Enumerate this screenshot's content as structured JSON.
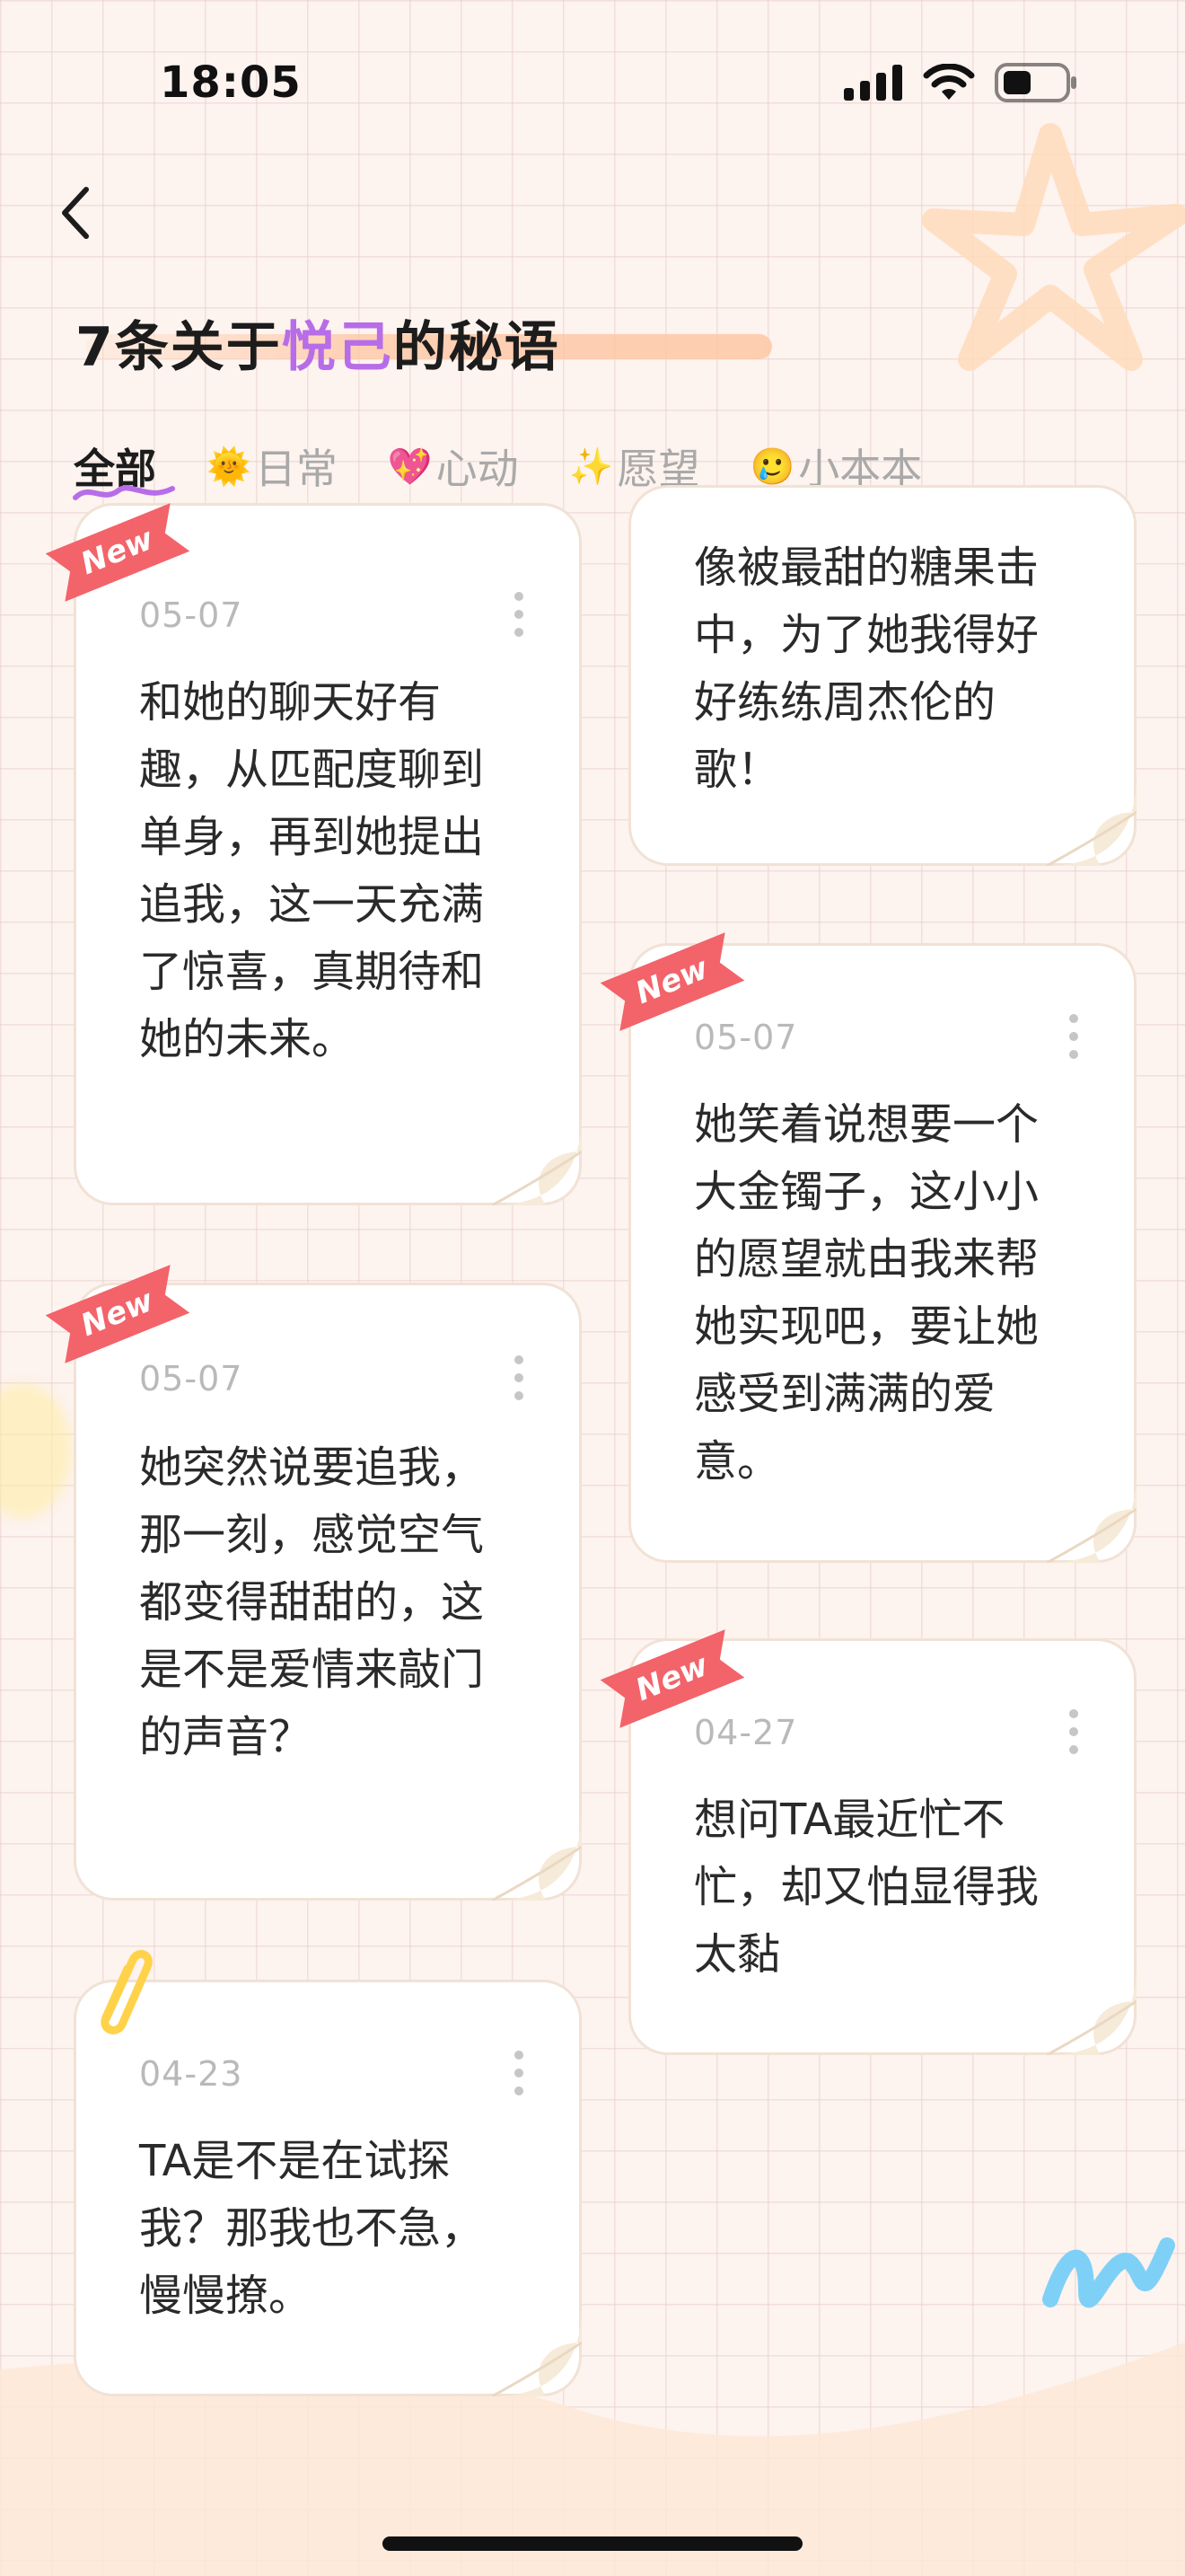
{
  "status_bar": {
    "time": "18:05"
  },
  "header": {
    "title_prefix": "7条关于",
    "title_accent": "悦己",
    "title_suffix": "的秘语"
  },
  "tabs": [
    {
      "label": "全部",
      "emoji": "",
      "active": true
    },
    {
      "label": "日常",
      "emoji": "🌞",
      "active": false
    },
    {
      "label": "心动",
      "emoji": "💖",
      "active": false
    },
    {
      "label": "愿望",
      "emoji": "✨",
      "active": false
    },
    {
      "label": "小本本",
      "emoji": "🥲",
      "active": false
    }
  ],
  "new_tag": "New",
  "cards": [
    {
      "date": "05-07",
      "new": true,
      "text": "和她的聊天好有趣，从匹配度聊到单身，再到她提出追我，这一天充满了惊喜，真期待和她的未来。"
    },
    {
      "date": "",
      "new": false,
      "text": "像被最甜的糖果击中，为了她我得好好练练周杰伦的歌！"
    },
    {
      "date": "05-07",
      "new": true,
      "text": "她笑着说想要一个大金镯子，这小小的愿望就由我来帮她实现吧，要让她感受到满满的爱意。"
    },
    {
      "date": "05-07",
      "new": true,
      "text": "她突然说要追我，那一刻，感觉空气都变得甜甜的，这是不是爱情来敲门的声音？"
    },
    {
      "date": "04-27",
      "new": true,
      "text": "想问TA最近忙不忙，却又怕显得我太黏"
    },
    {
      "date": "04-23",
      "new": false,
      "text": "TA是不是在试探我？那我也不急，慢慢撩。"
    }
  ],
  "colors": {
    "accent": "#b76de8",
    "new_tag": "#f3636a",
    "background": "#fdf3ef"
  }
}
